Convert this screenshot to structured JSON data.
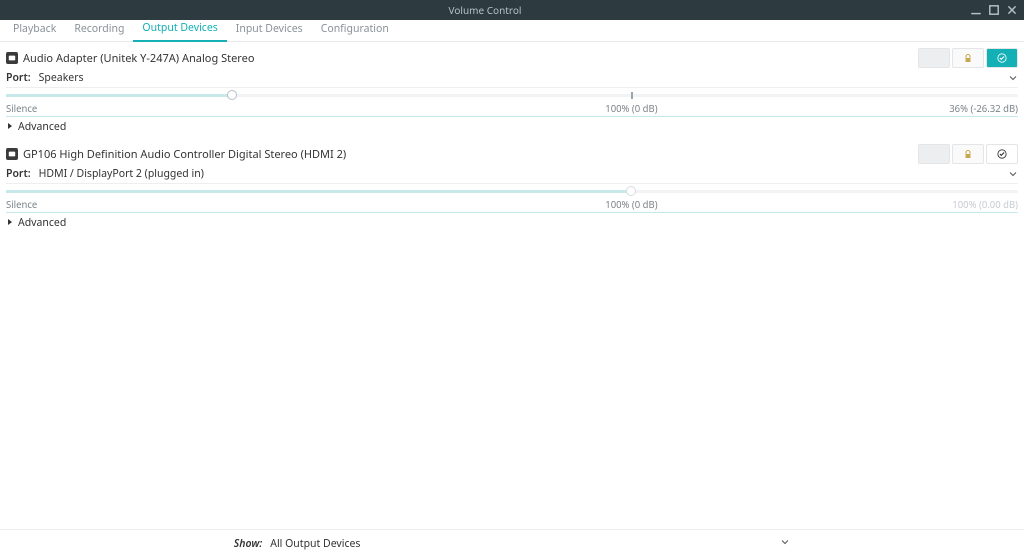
{
  "window": {
    "title": "Volume Control"
  },
  "tabs": [
    {
      "label": "Playback"
    },
    {
      "label": "Recording"
    },
    {
      "label": "Output Devices"
    },
    {
      "label": "Input Devices"
    },
    {
      "label": "Configuration"
    }
  ],
  "active_tab_index": 2,
  "devices": [
    {
      "name": "Audio Adapter (Unitek Y-247A) Analog Stereo",
      "port_label": "Port:",
      "port": "Speakers",
      "is_default": true,
      "volume_percent": 36,
      "current_label": "36% (-26.32 dB)",
      "advanced_label": "Advanced"
    },
    {
      "name": "GP106 High Definition Audio Controller Digital Stereo (HDMI 2)",
      "port_label": "Port:",
      "port": "HDMI / DisplayPort 2 (plugged in)",
      "is_default": false,
      "volume_percent": 100,
      "current_label": "100% (0.00 dB)",
      "advanced_label": "Advanced"
    }
  ],
  "slider": {
    "silence_label": "Silence",
    "hundred_label": "100% (0 dB)"
  },
  "footer": {
    "show_label": "Show:",
    "show_value": "All Output Devices"
  }
}
